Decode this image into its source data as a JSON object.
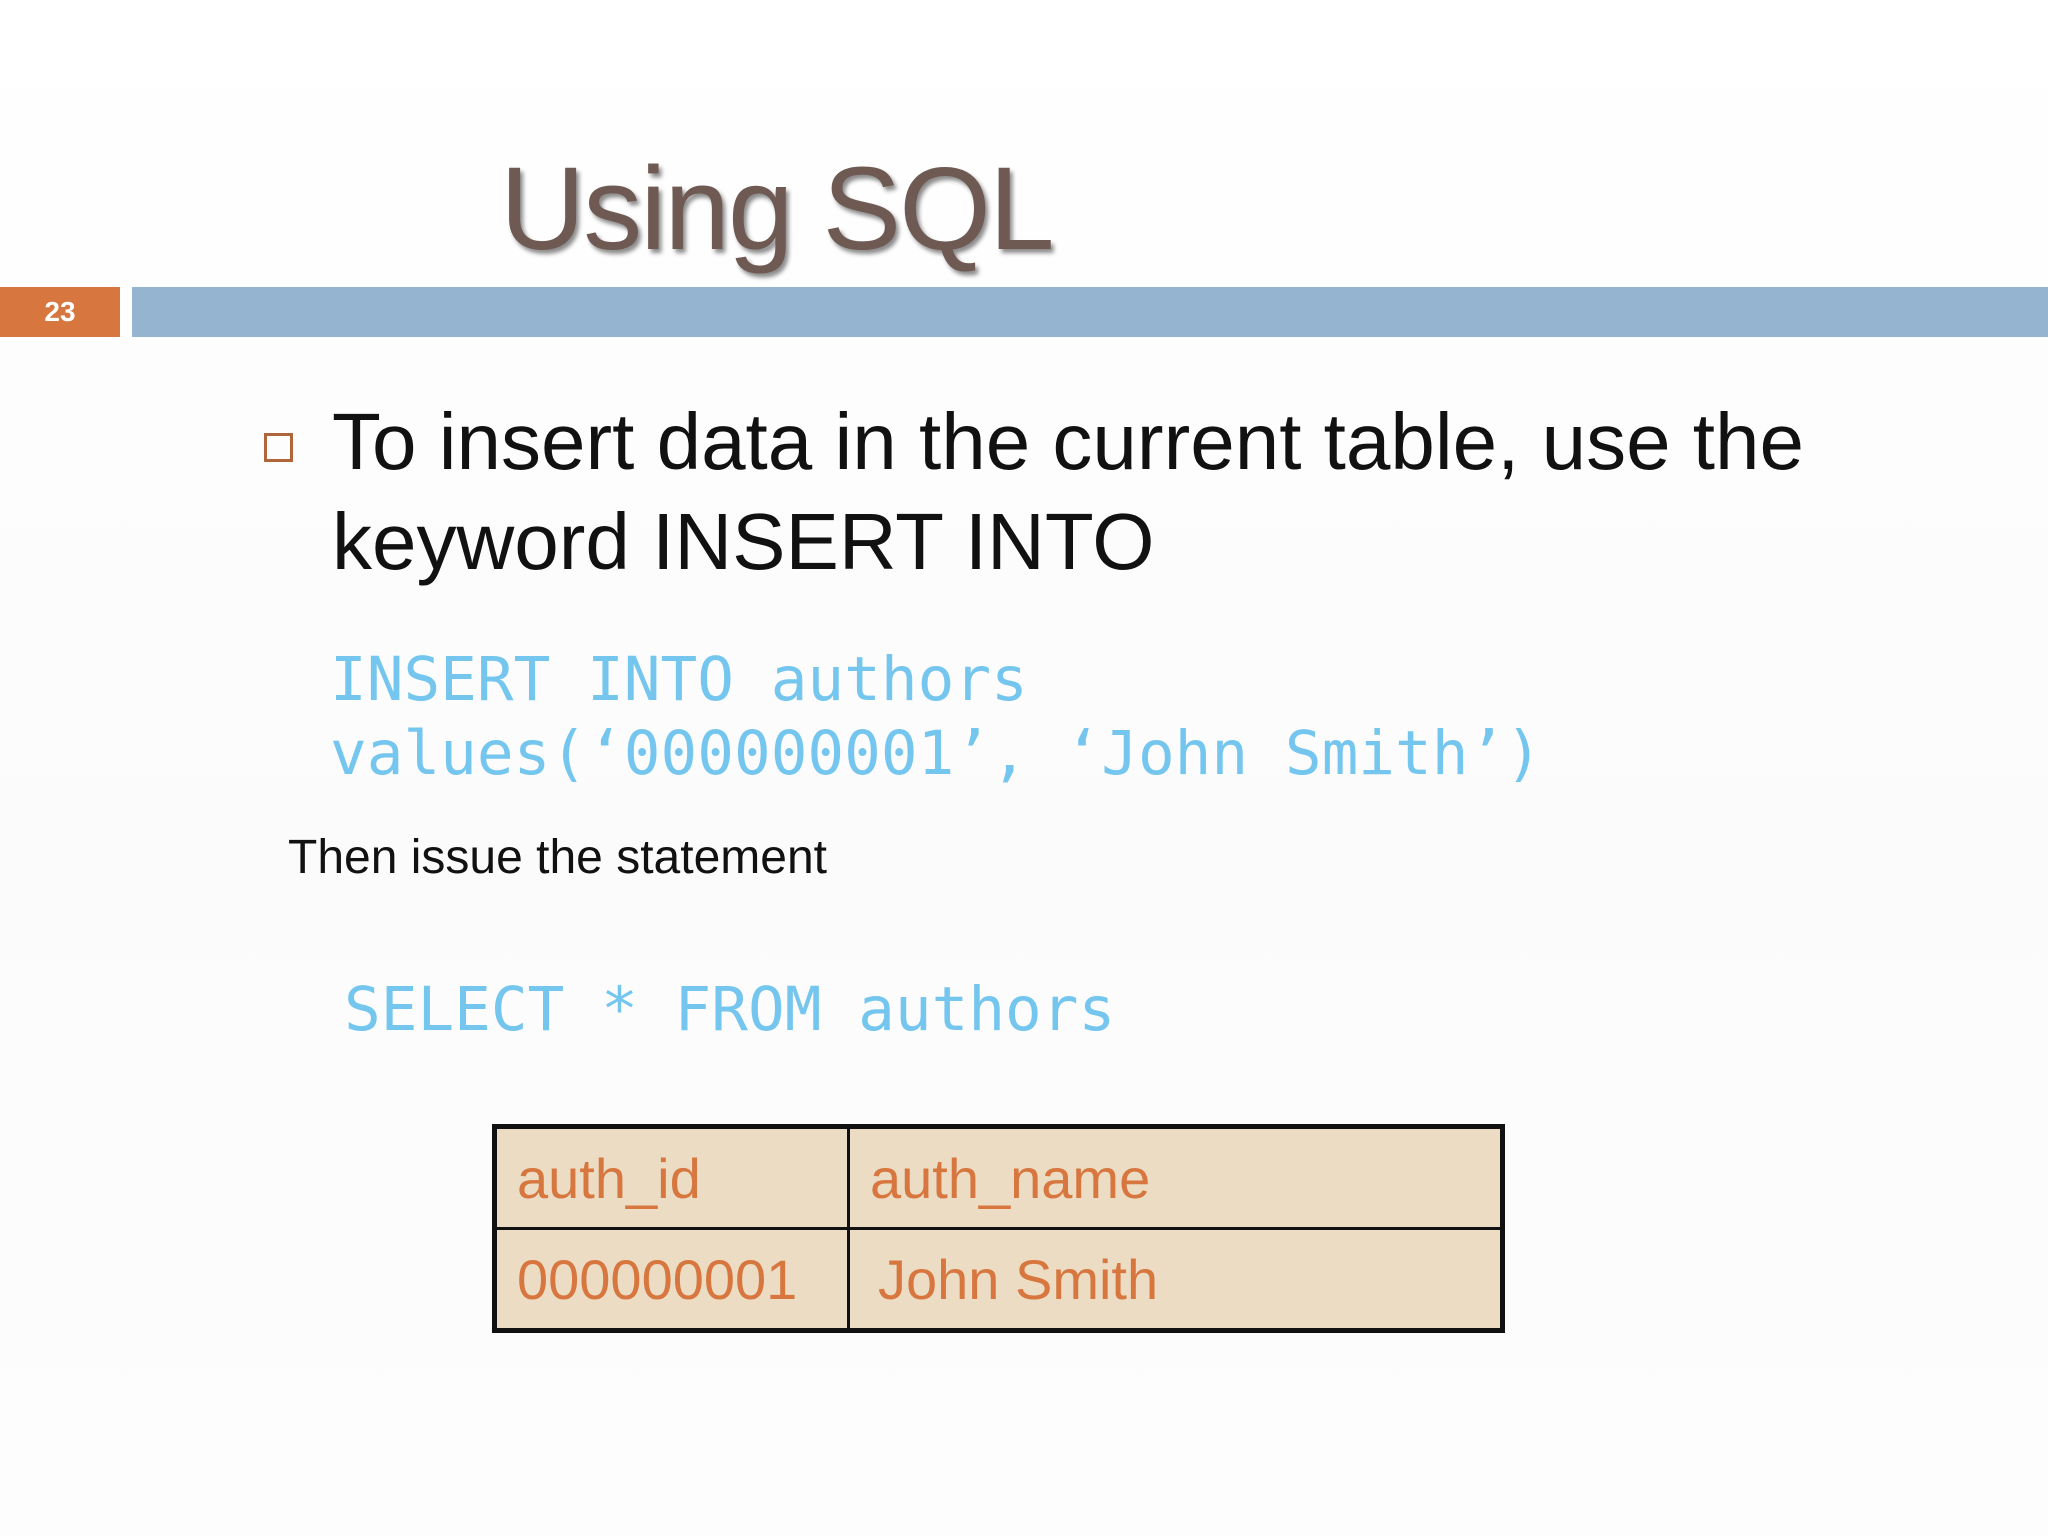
{
  "slide": {
    "title": "Using SQL",
    "number": "23",
    "bullet": "To insert data in the current table, use the keyword INSERT INTO",
    "code_insert_line1": "INSERT INTO authors",
    "code_insert_line2": "values(‘000000001’, ‘John Smith’)",
    "then_text": "Then issue the statement",
    "code_select": "SELECT * FROM authors",
    "table": {
      "headers": [
        "auth_id",
        "auth_name"
      ],
      "rows": [
        [
          "000000001",
          "John Smith"
        ]
      ]
    }
  },
  "colors": {
    "title": "#6e5a52",
    "slide_number_box": "#d7773f",
    "title_bar": "#94b4cf",
    "code": "#74c6ef",
    "table_text": "#d7773f",
    "table_background": "#ebdcc3"
  },
  "icons": {
    "bullet": "hollow-square-bullet-icon"
  }
}
